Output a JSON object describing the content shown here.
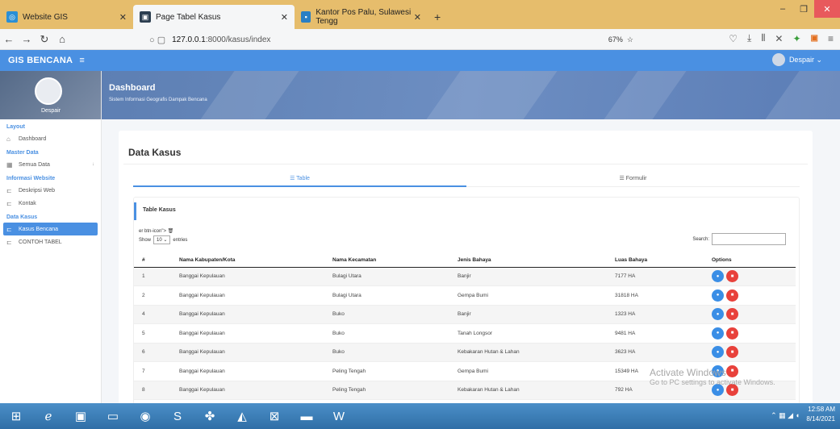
{
  "browser": {
    "tabs": [
      {
        "title": "Website GIS",
        "favicon": "gis-icon"
      },
      {
        "title": "Page Tabel Kasus",
        "favicon": "page-icon"
      },
      {
        "title": "Kantor Pos Palu, Sulawesi Tengg",
        "favicon": "map-icon"
      }
    ],
    "url_host": "127.0.0.1",
    "url_rest": ":8000/kasus/index",
    "zoom": "67%"
  },
  "app": {
    "brand": "GIS BENCANA",
    "user": "Despair"
  },
  "sidebar": {
    "profile_name": "Despair",
    "sections": [
      {
        "title": "Layout",
        "items": [
          {
            "label": "Dashboard",
            "icon": "home-icon"
          }
        ]
      },
      {
        "title": "Master Data",
        "items": [
          {
            "label": "Semua Data",
            "icon": "grid-icon"
          }
        ]
      },
      {
        "title": "Informasi Website",
        "items": [
          {
            "label": "Deskripsi Web",
            "icon": "doc-icon"
          },
          {
            "label": "Kontak",
            "icon": "doc-icon"
          }
        ]
      },
      {
        "title": "Data Kasus",
        "items": [
          {
            "label": "Kasus Bencana",
            "icon": "doc-icon",
            "active": true
          },
          {
            "label": "CONTOH TABEL",
            "icon": "doc-icon"
          }
        ]
      }
    ]
  },
  "banner": {
    "title": "Dashboard",
    "subtitle": "Sistem Informasi Geografis Dampak Bencana"
  },
  "card": {
    "title": "Data Kasus",
    "tab_table": "Table",
    "tab_form": "Formulir"
  },
  "table_panel": {
    "title": "Table Kasus",
    "btn_icon_text": "er btn-icon\">",
    "show_label": "Show",
    "entries_value": "10",
    "entries_label": "entries",
    "search_label": "Search:",
    "columns": [
      "#",
      "Nama Kabupaten/Kota",
      "Nama Kecamatan",
      "Jenis Bahaya",
      "Luas Bahaya",
      "Options"
    ],
    "rows": [
      [
        "1",
        "Banggai Kepulauan",
        "Bulagi Utara",
        "Banjir",
        "7177 HA"
      ],
      [
        "2",
        "Banggai Kepulauan",
        "Bulagi Utara",
        "Gempa Bumi",
        "31818 HA"
      ],
      [
        "4",
        "Banggai Kepulauan",
        "Buko",
        "Banjir",
        "1323 HA"
      ],
      [
        "5",
        "Banggai Kepulauan",
        "Buko",
        "Tanah Longsor",
        "9481 HA"
      ],
      [
        "6",
        "Banggai Kepulauan",
        "Buko",
        "Kebakaran Hutan & Lahan",
        "3623 HA"
      ],
      [
        "7",
        "Banggai Kepulauan",
        "Peling Tengah",
        "Gempa Bumi",
        "15349 HA"
      ],
      [
        "8",
        "Banggai Kepulauan",
        "Peling Tengah",
        "Kebakaran Hutan & Lahan",
        "792 HA"
      ]
    ]
  },
  "watermark": {
    "line1": "Activate Windows",
    "line2": "Go to PC settings to activate Windows."
  },
  "taskbar": {
    "time": "12:58 AM",
    "date": "8/14/2021"
  }
}
